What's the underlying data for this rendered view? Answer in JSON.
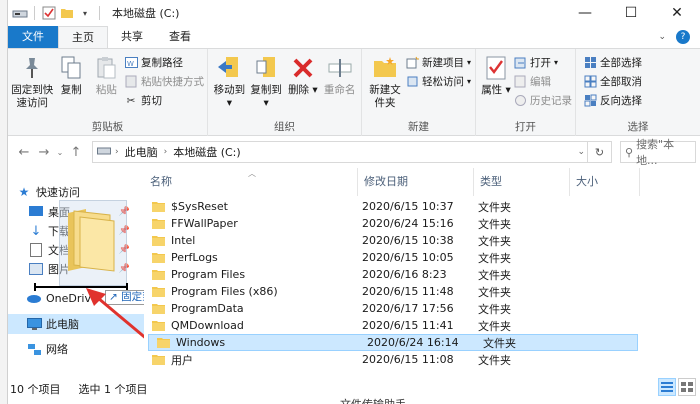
{
  "window": {
    "title": "本地磁盘 (C:)",
    "minimize": "—",
    "maximize": "☐",
    "close": "✕"
  },
  "tabs": [
    {
      "label": "文件"
    },
    {
      "label": "主页"
    },
    {
      "label": "共享"
    },
    {
      "label": "查看"
    }
  ],
  "ribbon": {
    "clipboard": {
      "label": "剪贴板",
      "pin": "固定到快速访问",
      "copy": "复制",
      "paste": "粘贴",
      "copy_path": "复制路径",
      "paste_shortcut": "粘贴快捷方式",
      "cut": "剪切"
    },
    "organize": {
      "label": "组织",
      "move_to": "移动到",
      "copy_to": "复制到",
      "delete": "删除",
      "rename": "重命名"
    },
    "new": {
      "label": "新建",
      "new_folder": "新建文件夹",
      "new_item": "新建项目",
      "easy_access": "轻松访问"
    },
    "open": {
      "label": "打开",
      "properties": "属性",
      "open": "打开",
      "edit": "编辑",
      "history": "历史记录"
    },
    "select": {
      "label": "选择",
      "select_all": "全部选择",
      "select_none": "全部取消",
      "invert": "反向选择"
    }
  },
  "address": {
    "crumbs": [
      "此电脑",
      "本地磁盘 (C:)"
    ],
    "search_placeholder": "搜索\"本地..."
  },
  "nav": {
    "quick_access": "快速访问",
    "items": [
      {
        "label": "桌面"
      },
      {
        "label": "下载"
      },
      {
        "label": "文档"
      },
      {
        "label": "图片"
      }
    ],
    "onedrive": "OneDrive",
    "this_pc": "此电脑",
    "network": "网络"
  },
  "drag": {
    "tooltip": "固定到快速访问"
  },
  "columns": {
    "name": "名称",
    "date": "修改日期",
    "type": "类型",
    "size": "大小"
  },
  "files": [
    {
      "name": "$SysReset",
      "date": "2020/6/15 10:37",
      "type": "文件夹"
    },
    {
      "name": "FFWallPaper",
      "date": "2020/6/24 15:16",
      "type": "文件夹"
    },
    {
      "name": "Intel",
      "date": "2020/6/15 10:38",
      "type": "文件夹"
    },
    {
      "name": "PerfLogs",
      "date": "2020/6/15 10:05",
      "type": "文件夹"
    },
    {
      "name": "Program Files",
      "date": "2020/6/16 8:23",
      "type": "文件夹"
    },
    {
      "name": "Program Files (x86)",
      "date": "2020/6/15 11:48",
      "type": "文件夹"
    },
    {
      "name": "ProgramData",
      "date": "2020/6/17 17:56",
      "type": "文件夹"
    },
    {
      "name": "QMDownload",
      "date": "2020/6/15 11:41",
      "type": "文件夹"
    },
    {
      "name": "Windows",
      "date": "2020/6/24 16:14",
      "type": "文件夹",
      "selected": true
    },
    {
      "name": "用户",
      "date": "2020/6/15 11:08",
      "type": "文件夹"
    }
  ],
  "status": {
    "count": "10 个项目",
    "selected": "选中 1 个项目"
  },
  "background": {
    "partial_text": "文件传输助手"
  },
  "colors": {
    "accent": "#1979ca",
    "selection": "#cce8ff",
    "folder": "#f3c84e",
    "arrow": "#e0322d"
  }
}
